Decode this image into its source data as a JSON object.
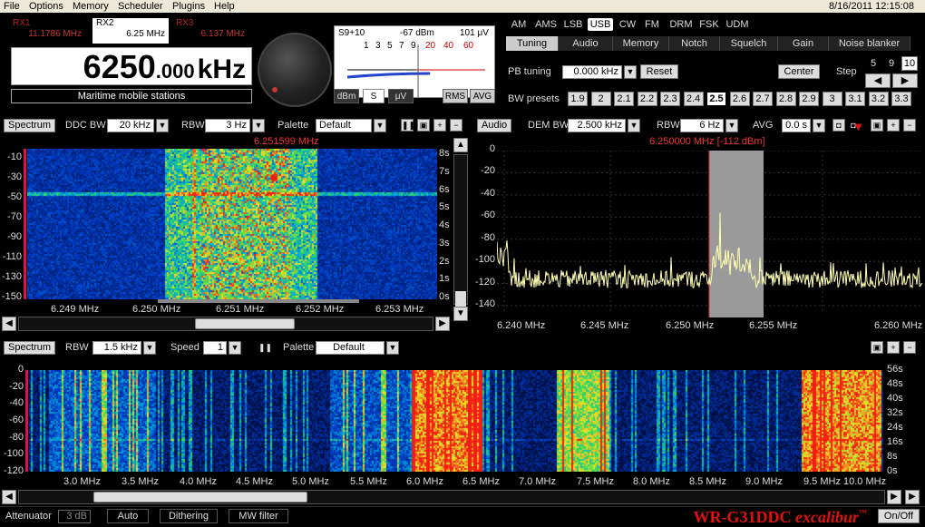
{
  "menu": {
    "items": [
      "File",
      "Options",
      "Memory",
      "Scheduler",
      "Plugins",
      "Help"
    ],
    "datetime": "8/16/2011 12:15:08"
  },
  "receivers": [
    {
      "name": "RX1",
      "freq": "11.1786 MHz",
      "active": false
    },
    {
      "name": "RX2",
      "freq": "6.25 MHz",
      "active": true
    },
    {
      "name": "RX3",
      "freq": "6.137 MHz",
      "active": false
    }
  ],
  "frequency": {
    "main": "6250",
    "fraction": ".000",
    "unit": "kHz",
    "station": "Maritime mobile stations"
  },
  "smeter": {
    "signal": "S9+10",
    "dbm": "-67 dBm",
    "uv": "101 μV",
    "scale": [
      "1",
      "3",
      "5",
      "7",
      "9"
    ],
    "scale_over": [
      "20",
      "40",
      "60"
    ],
    "buttons": [
      "dBm",
      "S",
      "μV",
      "RMS",
      "AVG"
    ],
    "selected": "S",
    "level_db": -67
  },
  "modes": {
    "items": [
      "AM",
      "AMS",
      "LSB",
      "USB",
      "CW",
      "FM",
      "DRM",
      "FSK",
      "UDM"
    ],
    "selected": "USB"
  },
  "tabs": {
    "items": [
      "Tuning",
      "Audio",
      "Memory",
      "Notch",
      "Squelch",
      "Gain",
      "Noise blanker"
    ],
    "selected": "Tuning"
  },
  "tuning": {
    "pb_label": "PB tuning",
    "pb_value": "0.000 kHz",
    "reset": "Reset",
    "center": "Center",
    "step_label": "Step",
    "steps": [
      "5",
      "9",
      "10"
    ],
    "step_selected": "10",
    "bw_label": "BW presets",
    "presets": [
      "1.9",
      "2",
      "2.1",
      "2.2",
      "2.3",
      "2.4",
      "2.5",
      "2.6",
      "2.7",
      "2.8",
      "2.9",
      "3",
      "3.1",
      "3.2",
      "3.3"
    ],
    "preset_selected": "2.5"
  },
  "ddc_panel": {
    "title": "Spectrum",
    "ddc_bw_label": "DDC BW",
    "ddc_bw": "20 kHz",
    "rbw_label": "RBW",
    "rbw": "3 Hz",
    "palette_label": "Palette",
    "palette": "Default",
    "cursor_freq": "6.251599 MHz",
    "y_labels": [
      "-10",
      "-30",
      "-50",
      "-70",
      "-90",
      "-110",
      "-130",
      "-150"
    ],
    "t_labels": [
      "8s",
      "7s",
      "6s",
      "5s",
      "4s",
      "3s",
      "2s",
      "1s",
      "0s"
    ],
    "x_labels": [
      "6.249 MHz",
      "6.250 MHz",
      "6.251 MHz",
      "6.252 MHz",
      "6.253 MHz"
    ]
  },
  "audio_panel": {
    "title": "Audio",
    "dem_bw_label": "DEM BW",
    "dem_bw": "2.500 kHz",
    "rbw_label": "RBW",
    "rbw": "6 Hz",
    "avg_label": "AVG",
    "avg": "0.0 s",
    "marker": "6.250000 MHz [-112 dBm]",
    "y_labels": [
      "0",
      "-20",
      "-40",
      "-60",
      "-80",
      "-100",
      "-120",
      "-140"
    ],
    "x_labels": [
      "6.240 MHz",
      "6.245 MHz",
      "6.250 MHz",
      "6.255 MHz",
      "6.260 MHz"
    ]
  },
  "wide_panel": {
    "title": "Spectrum",
    "rbw_label": "RBW",
    "rbw": "1.5 kHz",
    "speed_label": "Speed",
    "speed": "1",
    "palette_label": "Palette",
    "palette": "Default",
    "y_labels": [
      "0",
      "-20",
      "-40",
      "-60",
      "-80",
      "-100",
      "-120"
    ],
    "t_labels": [
      "56s",
      "48s",
      "40s",
      "32s",
      "24s",
      "16s",
      "8s",
      "0s"
    ],
    "x_labels": [
      "3.0 MHz",
      "3.5 MHz",
      "4.0 MHz",
      "4.5 MHz",
      "5.0 MHz",
      "5.5 MHz",
      "6.0 MHz",
      "6.5 MHz",
      "7.0 MHz",
      "7.5 MHz",
      "8.0 MHz",
      "8.5 MHz",
      "9.0 MHz",
      "9.5 MHz",
      "10.0 MHz"
    ]
  },
  "bottom": {
    "attenuator_label": "Attenuator",
    "attenuator": "3 dB",
    "auto": "Auto",
    "dithering": "Dithering",
    "mw_filter": "MW filter",
    "brand_model": "WR-G31DDC",
    "brand_name": "excalibur",
    "brand_tm": "™",
    "onoff": "On/Off"
  },
  "colors": {
    "accent_red": "#e01010",
    "trace": "#ffffb0",
    "passband": "#9a9a9a"
  }
}
